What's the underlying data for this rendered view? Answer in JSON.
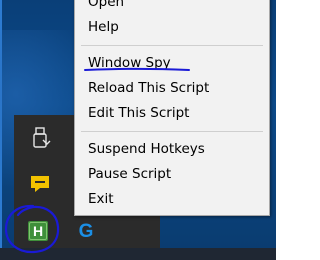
{
  "context_menu": {
    "items": [
      {
        "label": "Open"
      },
      {
        "label": "Help"
      },
      {
        "label": "Window Spy"
      },
      {
        "label": "Reload This Script"
      },
      {
        "label": "Edit This Script"
      },
      {
        "label": "Suspend Hotkeys"
      },
      {
        "label": "Pause Script"
      },
      {
        "label": "Exit"
      }
    ]
  },
  "tray": {
    "icons": [
      "usb-drive-icon",
      "chat-icon",
      "autohotkey-icon",
      "logitech-g-icon"
    ],
    "ahk_letter": "H",
    "g_letter": "G"
  },
  "colors": {
    "desktop": "#0c4a8a",
    "tray_bg": "#2b2b2b",
    "menu_bg": "#f2f2f2",
    "annotation": "#1a1ad6",
    "ahk_green": "#3f8f3a",
    "chat_yellow": "#f2c200",
    "logitech_blue": "#1b8fe6"
  }
}
